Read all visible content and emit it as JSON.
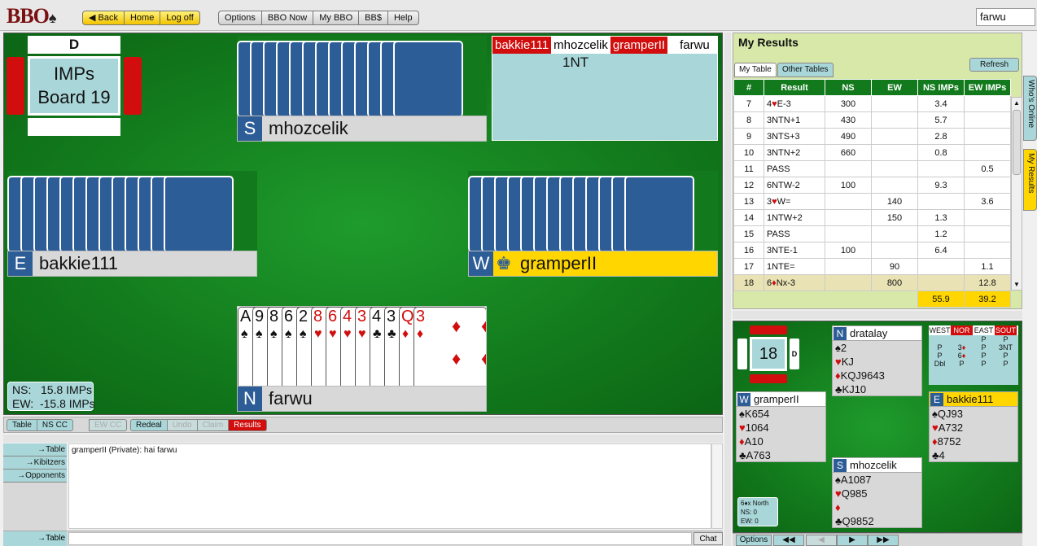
{
  "topbar": {
    "logo": "BBO",
    "logo_suit": "♠",
    "nav1": [
      "◀ Back",
      "Home",
      "Log off"
    ],
    "nav2": [
      "Options",
      "BBO Now",
      "My BBO",
      "BB$",
      "Help"
    ],
    "username": "farwu"
  },
  "table": {
    "dealer": "D",
    "scoring": "IMPs",
    "board": "Board 19",
    "north": {
      "seat": "N",
      "name": "farwu"
    },
    "south": {
      "seat": "S",
      "name": "mhozcelik"
    },
    "east": {
      "seat": "E",
      "name": "bakkie111"
    },
    "west": {
      "seat": "W",
      "name": "gramperII",
      "icon": "crown-icon"
    },
    "auction_header": [
      "bakkie111",
      "mhozcelik",
      "gramperII",
      "farwu"
    ],
    "auction_bid": "1NT",
    "north_hand": [
      {
        "rank": "A",
        "suit": "♠",
        "color": "black"
      },
      {
        "rank": "9",
        "suit": "♠",
        "color": "black"
      },
      {
        "rank": "8",
        "suit": "♠",
        "color": "black"
      },
      {
        "rank": "6",
        "suit": "♠",
        "color": "black"
      },
      {
        "rank": "2",
        "suit": "♠",
        "color": "black"
      },
      {
        "rank": "8",
        "suit": "♥",
        "color": "red"
      },
      {
        "rank": "6",
        "suit": "♥",
        "color": "red"
      },
      {
        "rank": "4",
        "suit": "♥",
        "color": "red"
      },
      {
        "rank": "3",
        "suit": "♥",
        "color": "red"
      },
      {
        "rank": "4",
        "suit": "♣",
        "color": "black"
      },
      {
        "rank": "3",
        "suit": "♣",
        "color": "black"
      },
      {
        "rank": "Q",
        "suit": "♦",
        "color": "red"
      },
      {
        "rank": "3",
        "suit": "♦",
        "color": "red"
      }
    ],
    "score_ns": "NS:   15.8 IMPs",
    "score_ew": "EW:  -15.8 IMPs"
  },
  "actions": [
    "Table",
    "NS CC",
    "EW CC",
    "Redeal",
    "Undo",
    "Claim",
    "Results"
  ],
  "chat": {
    "targets": [
      "→Table",
      "→Kibitzers",
      "→Opponents"
    ],
    "message": "gramperII (Private): hai farwu",
    "send_target": "→Table",
    "chat_button": "Chat"
  },
  "results": {
    "title": "My Results",
    "tabs": [
      "My Table",
      "Other Tables"
    ],
    "refresh": "Refresh",
    "columns": [
      "#",
      "Result",
      "NS",
      "EW",
      "NS IMPs",
      "EW IMPs"
    ],
    "rows": [
      [
        "7",
        "4♥E-3",
        "300",
        "",
        "3.4",
        ""
      ],
      [
        "8",
        "3NTN+1",
        "430",
        "",
        "5.7",
        ""
      ],
      [
        "9",
        "3NTS+3",
        "490",
        "",
        "2.8",
        ""
      ],
      [
        "10",
        "3NTN+2",
        "660",
        "",
        "0.8",
        ""
      ],
      [
        "11",
        "PASS",
        "",
        "",
        "",
        "0.5"
      ],
      [
        "12",
        "6NTW-2",
        "100",
        "",
        "9.3",
        ""
      ],
      [
        "13",
        "3♥W=",
        "",
        "140",
        "",
        "3.6"
      ],
      [
        "14",
        "1NTW+2",
        "",
        "150",
        "1.3",
        ""
      ],
      [
        "15",
        "PASS",
        "",
        "",
        "1.2",
        ""
      ],
      [
        "16",
        "3NTE-1",
        "100",
        "",
        "6.4",
        ""
      ],
      [
        "17",
        "1NTE=",
        "",
        "90",
        "",
        "1.1"
      ],
      [
        "18",
        "6♦Nx-3",
        "",
        "800",
        "",
        "12.8"
      ]
    ],
    "total_ns": "55.9",
    "total_ew": "39.2",
    "side_tabs": [
      "Who's Online",
      "My Results"
    ]
  },
  "mini": {
    "board_number": "18",
    "dealer": "D",
    "north": {
      "seat": "N",
      "name": "dratalay",
      "lines": [
        "♠2",
        "♥KJ",
        "♦KQJ9643",
        "♣KJ10"
      ]
    },
    "west": {
      "seat": "W",
      "name": "gramperII",
      "lines": [
        "♠K654",
        "♥1064",
        "♦A10",
        "♣A763"
      ]
    },
    "east": {
      "seat": "E",
      "name": "bakkie111",
      "lines": [
        "♠QJ93",
        "♥A732",
        "♦8752",
        "♣4"
      ]
    },
    "south": {
      "seat": "S",
      "name": "mhozcelik",
      "lines": [
        "♠A1087",
        "♥Q985",
        "♦",
        "♣Q9852"
      ]
    },
    "auction_header": [
      "WEST",
      "NOR",
      "EAST",
      "SOUT"
    ],
    "auction_rows": [
      [
        "",
        "",
        "P",
        "P"
      ],
      [
        "P",
        "3♦",
        "P",
        "3NT"
      ],
      [
        "P",
        "6♦",
        "P",
        "P"
      ],
      [
        "Dbl",
        "P",
        "P",
        "P"
      ]
    ],
    "result": [
      "6♦x North",
      "NS: 0",
      "EW: 0"
    ],
    "controls": [
      "Options",
      "◀◀",
      "◀",
      "▶",
      "▶▶"
    ]
  },
  "colors": {
    "felt": "#127a1c",
    "accent_red": "#d10d0d",
    "panel": "#a9d7d9",
    "turn": "#ffd600",
    "card_back": "#2d5d96"
  }
}
